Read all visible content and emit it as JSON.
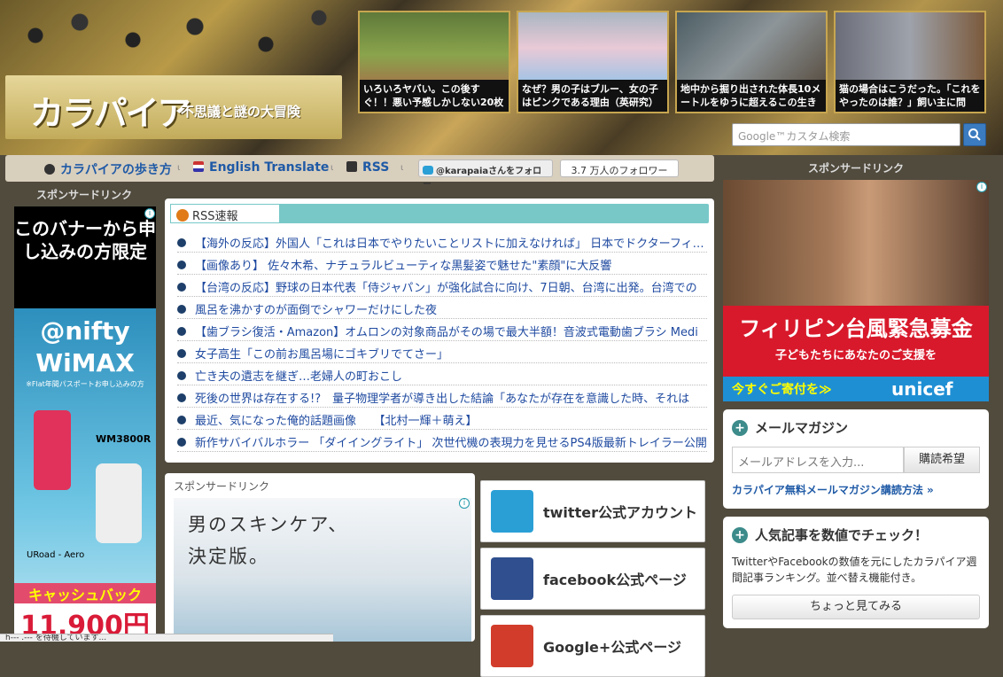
{
  "header": {
    "logo": "カラパイア",
    "tagline": "不思議と謎の大冒険",
    "featured": [
      {
        "caption": "いろいろヤバい。この後すぐ！！悪い予感しかしない20枚"
      },
      {
        "caption": "なぜ？男の子はブルー、女の子はピンクである理由（英研究）"
      },
      {
        "caption": "地中から掘り出された体長10メートルをゆうに超えるこの生き"
      },
      {
        "caption": "猫の場合はこうだった。「これをやったのは誰？」飼い主に問"
      }
    ],
    "search_placeholder": "Google™カスタム検索",
    "search_icon": "magnifier-icon"
  },
  "nav": {
    "items": [
      {
        "label": "カラパイアの歩き方",
        "icon": "globe-icon"
      },
      {
        "label": "English Translate",
        "icon": "flag-icon"
      },
      {
        "label": "RSS",
        "icon": "rss-icon"
      }
    ],
    "separator": "ι",
    "twitter_follow": "@karapaiaさんをフォロー",
    "twitter_count": "3.7 万人のフォロワー"
  },
  "left_ad": {
    "sponsor_label": "スポンサードリンク",
    "top_text": "このバナーから申し込みの方限定",
    "brand": "@nifty WiMAX",
    "note": "※Flat年間パスポートお申し込みの方",
    "model": "WM3800R",
    "uroad": "URoad - Aero",
    "cashback": "キャッシュバック",
    "price": "11,900円"
  },
  "rss": {
    "title": "RSS速報",
    "items": [
      "【海外の反応】外国人「これは日本でやりたいことリストに加えなければ」 日本でドクターフィッシュ",
      "【画像あり】 佐々木希、ナチュラルビューティな黒髪姿で魅せた\"素顔\"に大反響",
      "【台湾の反応】野球の日本代表「侍ジャパン」が強化試合に向け、7日朝、台湾に出発。台湾での",
      "風呂を沸かすのが面倒でシャワーだけにした夜",
      "【歯ブラシ復活・Amazon】オムロンの対象商品がその場で最大半額！音波式電動歯ブラシ Medi",
      "女子高生「この前お風呂場にゴキブリでてさー」",
      "亡き夫の遺志を継ぎ…老婦人の町おこし",
      "死後の世界は存在する!?　量子物理学者が導き出した結論「あなたが存在を意識した時、それは",
      "最近、気になった俺的話題画像　　【北村一輝＋萌え】",
      "新作サバイバルホラー 「ダイイングライト」 次世代機の表現力を見せるPS4版最新トレイラー公開"
    ]
  },
  "mid_ad": {
    "sponsor_label": "スポンサードリンク",
    "copy_line1": "男のスキンケア、",
    "copy_line2": "決定版。"
  },
  "social": [
    {
      "label": "twitter公式アカウント",
      "icon": "twitter-icon",
      "color": "#2a9fd6"
    },
    {
      "label": "facebook公式ページ",
      "icon": "facebook-icon",
      "color": "#2f4f8f"
    },
    {
      "label": "Google+公式ページ",
      "icon": "google-plus-icon",
      "color": "#d23d2b"
    }
  ],
  "right_ad": {
    "sponsor_label": "スポンサードリンク",
    "headline": "フィリピン台風緊急募金",
    "sub": "子どもたちにあなたのご支援を",
    "cta": "今すぐご寄付を≫",
    "brand": "unicef"
  },
  "mail_magazine": {
    "title": "メールマガジン",
    "placeholder": "メールアドレスを入力...",
    "button": "購読希望",
    "link": "カラパイア無料メールマガジン講読方法 »"
  },
  "ranking": {
    "title": "人気記事を数値でチェック！",
    "text": "TwitterやFacebookの数値を元にしたカラパイア週間記事ランキング。並べ替え機能付き。",
    "button": "ちょっと見てみる"
  },
  "status": "h--- .--- を待機しています..."
}
